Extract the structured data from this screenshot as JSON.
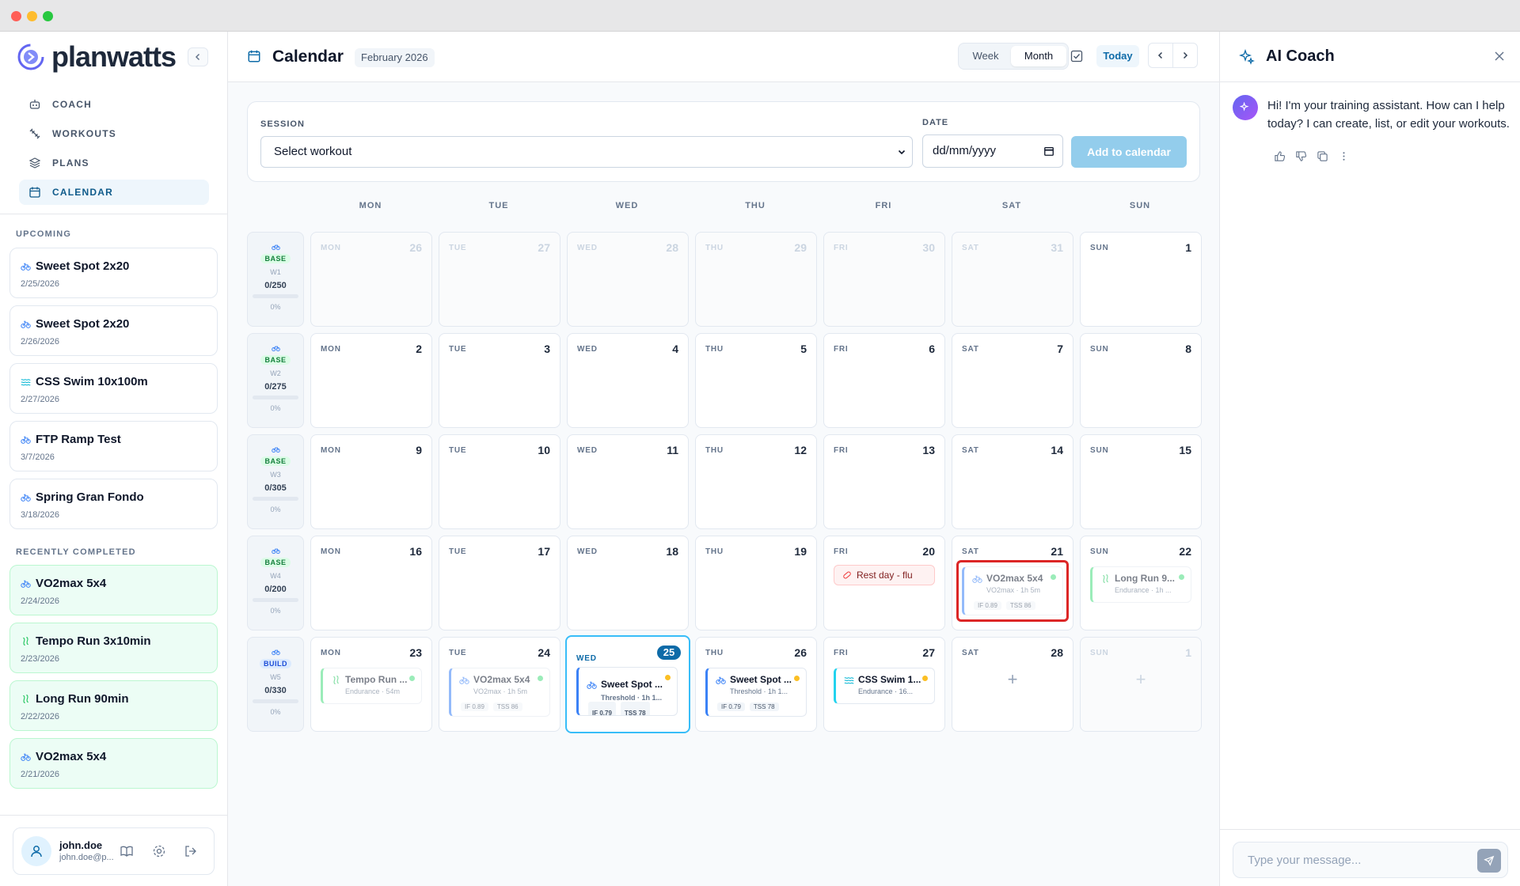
{
  "app": {
    "brand": "planwatts"
  },
  "nav": [
    {
      "label": "COACH",
      "icon": "robot-icon"
    },
    {
      "label": "WORKOUTS",
      "icon": "dumbbell-icon"
    },
    {
      "label": "PLANS",
      "icon": "layers-icon"
    },
    {
      "label": "CALENDAR",
      "icon": "calendar-icon",
      "active": true
    }
  ],
  "upcoming": {
    "label": "UPCOMING",
    "items": [
      {
        "title": "Sweet Spot 2x20",
        "date": "2/25/2026",
        "sport": "bike"
      },
      {
        "title": "Sweet Spot 2x20",
        "date": "2/26/2026",
        "sport": "bike"
      },
      {
        "title": "CSS Swim 10x100m",
        "date": "2/27/2026",
        "sport": "swim"
      },
      {
        "title": "FTP Ramp Test",
        "date": "3/7/2026",
        "sport": "bike"
      },
      {
        "title": "Spring Gran Fondo",
        "date": "3/18/2026",
        "sport": "bike"
      }
    ]
  },
  "completed": {
    "label": "RECENTLY COMPLETED",
    "items": [
      {
        "title": "VO2max 5x4",
        "date": "2/24/2026",
        "sport": "bike"
      },
      {
        "title": "Tempo Run 3x10min",
        "date": "2/23/2026",
        "sport": "run"
      },
      {
        "title": "Long Run 90min",
        "date": "2/22/2026",
        "sport": "run"
      },
      {
        "title": "VO2max 5x4",
        "date": "2/21/2026",
        "sport": "bike"
      }
    ]
  },
  "user": {
    "name": "john.doe",
    "email": "john.doe@p..."
  },
  "header": {
    "title": "Calendar",
    "month": "February 2026",
    "view_week": "Week",
    "view_month": "Month",
    "today": "Today"
  },
  "add_form": {
    "session_label": "SESSION",
    "session_value": "Select workout",
    "date_label": "DATE",
    "date_placeholder": "dd/mm/yyyy",
    "submit": "Add to calendar"
  },
  "weekdays": [
    "MON",
    "TUE",
    "WED",
    "THU",
    "FRI",
    "SAT",
    "SUN"
  ],
  "weeks": [
    {
      "phase": "BASE",
      "week": "W1",
      "load": "0/250",
      "pct": "0%",
      "days": [
        {
          "dow": "MON",
          "num": "26",
          "faded": true
        },
        {
          "dow": "TUE",
          "num": "27",
          "faded": true
        },
        {
          "dow": "WED",
          "num": "28",
          "faded": true
        },
        {
          "dow": "THU",
          "num": "29",
          "faded": true
        },
        {
          "dow": "FRI",
          "num": "30",
          "faded": true
        },
        {
          "dow": "SAT",
          "num": "31",
          "faded": true
        },
        {
          "dow": "SUN",
          "num": "1"
        }
      ]
    },
    {
      "phase": "BASE",
      "week": "W2",
      "load": "0/275",
      "pct": "0%",
      "days": [
        {
          "dow": "MON",
          "num": "2"
        },
        {
          "dow": "TUE",
          "num": "3"
        },
        {
          "dow": "WED",
          "num": "4"
        },
        {
          "dow": "THU",
          "num": "5"
        },
        {
          "dow": "FRI",
          "num": "6"
        },
        {
          "dow": "SAT",
          "num": "7"
        },
        {
          "dow": "SUN",
          "num": "8"
        }
      ]
    },
    {
      "phase": "BASE",
      "week": "W3",
      "load": "0/305",
      "pct": "0%",
      "days": [
        {
          "dow": "MON",
          "num": "9"
        },
        {
          "dow": "TUE",
          "num": "10"
        },
        {
          "dow": "WED",
          "num": "11"
        },
        {
          "dow": "THU",
          "num": "12"
        },
        {
          "dow": "FRI",
          "num": "13"
        },
        {
          "dow": "SAT",
          "num": "14"
        },
        {
          "dow": "SUN",
          "num": "15"
        }
      ]
    },
    {
      "phase": "BASE",
      "week": "W4",
      "load": "0/200",
      "pct": "0%",
      "days": [
        {
          "dow": "MON",
          "num": "16"
        },
        {
          "dow": "TUE",
          "num": "17"
        },
        {
          "dow": "WED",
          "num": "18"
        },
        {
          "dow": "THU",
          "num": "19"
        },
        {
          "dow": "FRI",
          "num": "20",
          "rest": "Rest day - flu"
        },
        {
          "dow": "SAT",
          "num": "21",
          "selected": true,
          "event": {
            "title": "VO2max 5x4",
            "sub": "VO2max · 1h 5m",
            "if": "IF 0.89",
            "tss": "TSS 86",
            "sport": "bike",
            "color": "blue",
            "faded": true,
            "status": "#4ade80"
          }
        },
        {
          "dow": "SUN",
          "num": "22",
          "event": {
            "title": "Long Run 9...",
            "sub": "Endurance · 1h ...",
            "sport": "run",
            "color": "green",
            "faded": true,
            "status": "#4ade80"
          }
        }
      ]
    },
    {
      "phase": "BUILD",
      "week": "W5",
      "load": "0/330",
      "pct": "0%",
      "days": [
        {
          "dow": "MON",
          "num": "23",
          "event": {
            "title": "Tempo Run ...",
            "sub": "Endurance · 54m",
            "sport": "run",
            "color": "green",
            "faded": true,
            "status": "#4ade80"
          }
        },
        {
          "dow": "TUE",
          "num": "24",
          "event": {
            "title": "VO2max 5x4",
            "sub": "VO2max · 1h 5m",
            "if": "IF 0.89",
            "tss": "TSS 86",
            "sport": "bike",
            "color": "blue",
            "faded": true,
            "status": "#4ade80"
          }
        },
        {
          "dow": "WED",
          "num": "25",
          "today": true,
          "event": {
            "title": "Sweet Spot ...",
            "sub": "Threshold · 1h 1...",
            "if": "IF 0.79",
            "tss": "TSS 78",
            "sport": "bike",
            "color": "blue",
            "status": "#fbbf24"
          }
        },
        {
          "dow": "THU",
          "num": "26",
          "event": {
            "title": "Sweet Spot ...",
            "sub": "Threshold · 1h 1...",
            "if": "IF 0.79",
            "tss": "TSS 78",
            "sport": "bike",
            "color": "blue",
            "status": "#fbbf24"
          }
        },
        {
          "dow": "FRI",
          "num": "27",
          "event": {
            "title": "CSS Swim 1...",
            "sub": "Endurance · 16...",
            "sport": "swim",
            "color": "teal",
            "status": "#fbbf24"
          }
        },
        {
          "dow": "SAT",
          "num": "28",
          "plus": "+"
        },
        {
          "dow": "SUN",
          "num": "1",
          "faded": true,
          "plus": "+"
        }
      ]
    }
  ],
  "coach": {
    "title": "AI Coach",
    "message": "Hi! I'm your training assistant. How can I help today? I can create, list, or edit your workouts.",
    "input_placeholder": "Type your message..."
  },
  "colors": {
    "accent": "#0e6ba8",
    "primary_button": "#93cdec",
    "selection": "#dc2626"
  }
}
